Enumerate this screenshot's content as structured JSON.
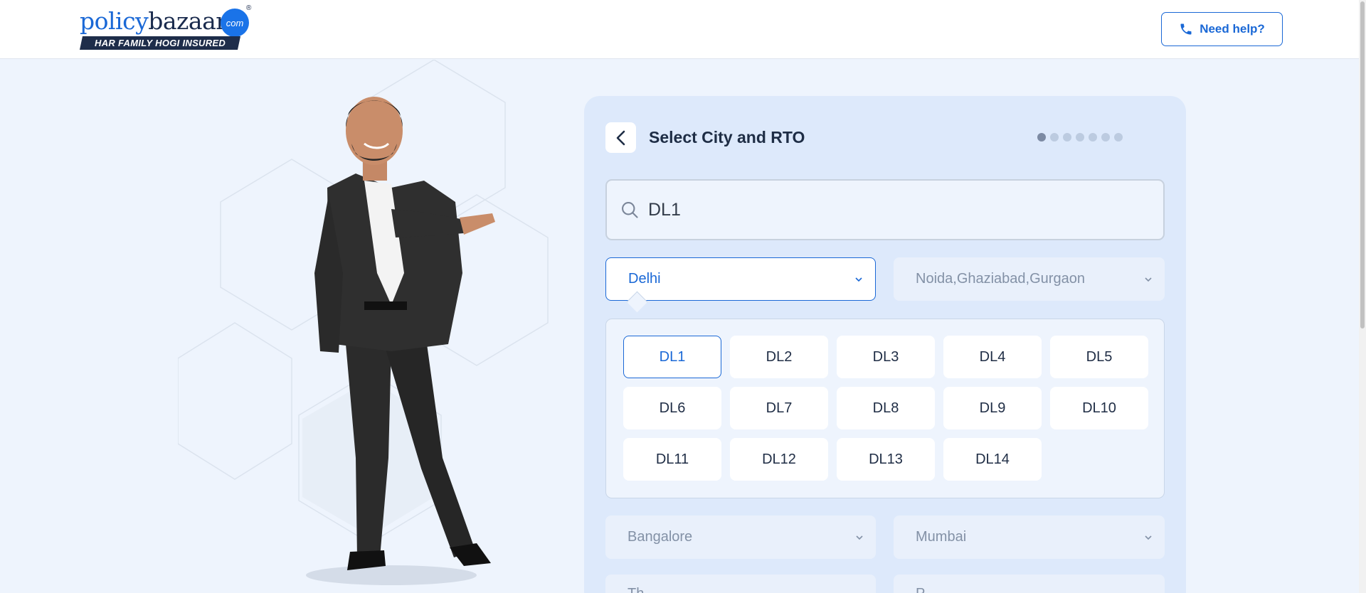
{
  "header": {
    "logo": {
      "word_part1": "policy",
      "word_part2": "bazaar",
      "com": "com",
      "reg": "®",
      "tagline": "HAR FAMILY HOGI INSURED"
    },
    "help_label": "Need help?"
  },
  "card": {
    "title": "Select City and RTO",
    "steps_total": 7,
    "step_current": 1,
    "search": {
      "value": "DL1",
      "placeholder": "Search"
    },
    "cities": [
      {
        "label": "Delhi",
        "selected": true
      },
      {
        "label": "Noida,Ghaziabad,Gurgaon",
        "selected": false
      },
      {
        "label": "Bangalore",
        "selected": false
      },
      {
        "label": "Mumbai",
        "selected": false
      },
      {
        "label": "Th...",
        "selected": false
      },
      {
        "label": "P...",
        "selected": false
      }
    ],
    "rto_codes": [
      "DL1",
      "DL2",
      "DL3",
      "DL4",
      "DL5",
      "DL6",
      "DL7",
      "DL8",
      "DL9",
      "DL10",
      "DL11",
      "DL12",
      "DL13",
      "DL14"
    ],
    "rto_selected": "DL1"
  },
  "icons": {
    "phone": "phone-icon",
    "back": "chevron-left-icon",
    "search": "search-icon",
    "dropdown": "chevron-down-icon"
  },
  "colors": {
    "brand": "#1a68d6",
    "card_bg": "#dde9fb",
    "page_bg": "#eef4fd"
  }
}
